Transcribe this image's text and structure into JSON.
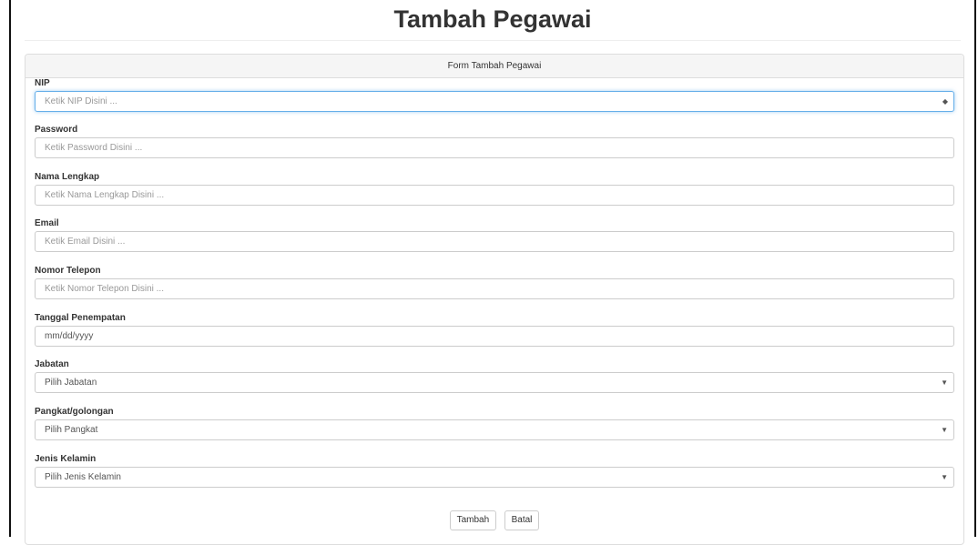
{
  "page": {
    "title": "Tambah Pegawai"
  },
  "form": {
    "heading": "Form Tambah Pegawai",
    "fields": [
      {
        "label": "NIP",
        "placeholder": "Ketik NIP Disini ..."
      },
      {
        "label": "Password",
        "placeholder": "Ketik Password Disini ..."
      },
      {
        "label": "Nama Lengkap",
        "placeholder": "Ketik Nama Lengkap Disini ..."
      },
      {
        "label": "Email",
        "placeholder": "Ketik Email Disini ..."
      },
      {
        "label": "Nomor Telepon",
        "placeholder": "Ketik Nomor Telepon Disini ..."
      },
      {
        "label": "Tanggal Penempatan",
        "placeholder": "mm/dd/yyyy"
      },
      {
        "label": "Jabatan",
        "value": "Pilih Jabatan"
      },
      {
        "label": "Pangkat/golongan",
        "value": "Pilih Pangkat"
      },
      {
        "label": "Jenis Kelamin",
        "value": "Pilih Jenis Kelamin"
      }
    ],
    "buttons": {
      "submit": "Tambah",
      "cancel": "Batal"
    }
  },
  "icons": {
    "spinner": "number-spinner-icon",
    "dropdown": "dropdown-arrow-icon"
  },
  "colors": {
    "focus_border": "#66afe9",
    "panel_heading_bg": "#f5f5f5"
  }
}
